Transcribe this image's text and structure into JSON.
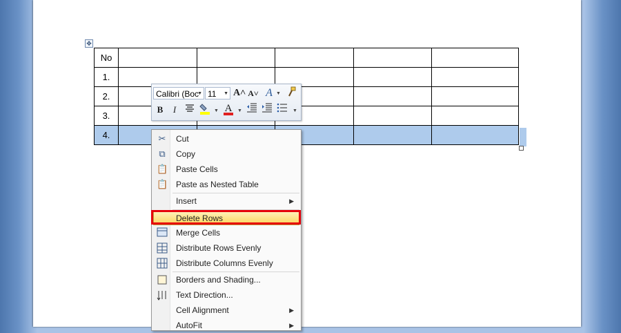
{
  "table": {
    "rows": [
      [
        "No",
        "",
        "",
        "",
        "",
        ""
      ],
      [
        "1.",
        "",
        "",
        "",
        "",
        ""
      ],
      [
        "2.",
        "",
        "",
        "",
        "",
        ""
      ],
      [
        "3.",
        "",
        "",
        "",
        "",
        ""
      ],
      [
        "4.",
        "",
        "",
        "",
        "",
        ""
      ]
    ]
  },
  "mini_toolbar": {
    "font_name": "Calibri (Boc",
    "font_size": "11",
    "grow_font_icon": "A˄",
    "shrink_font_icon": "A˅",
    "styles_icon": "A",
    "format_painter_icon": "brush-icon",
    "bold": "B",
    "italic": "I",
    "font_color_letter": "A",
    "highlight_color": "#ffff00",
    "font_color": "#e02020"
  },
  "context_menu": {
    "items": [
      {
        "label": "Cut",
        "icon": "scissors-icon"
      },
      {
        "label": "Copy",
        "icon": "copy-icon"
      },
      {
        "label": "Paste Cells",
        "icon": "paste-icon"
      },
      {
        "label": "Paste as Nested Table",
        "icon": "paste-icon"
      },
      {
        "label": "Insert",
        "icon": ""
      },
      {
        "label": "Delete Rows",
        "icon": ""
      },
      {
        "label": "Merge Cells",
        "icon": "merge-cells-icon"
      },
      {
        "label": "Distribute Rows Evenly",
        "icon": "distribute-rows-icon"
      },
      {
        "label": "Distribute Columns Evenly",
        "icon": "distribute-columns-icon"
      },
      {
        "label": "Borders and Shading...",
        "icon": "borders-icon"
      },
      {
        "label": "Text Direction...",
        "icon": "text-direction-icon"
      },
      {
        "label": "Cell Alignment",
        "icon": ""
      },
      {
        "label": "AutoFit",
        "icon": ""
      }
    ]
  },
  "colors": {
    "selection": "#aecbec",
    "highlight_box": "#e6000b"
  }
}
